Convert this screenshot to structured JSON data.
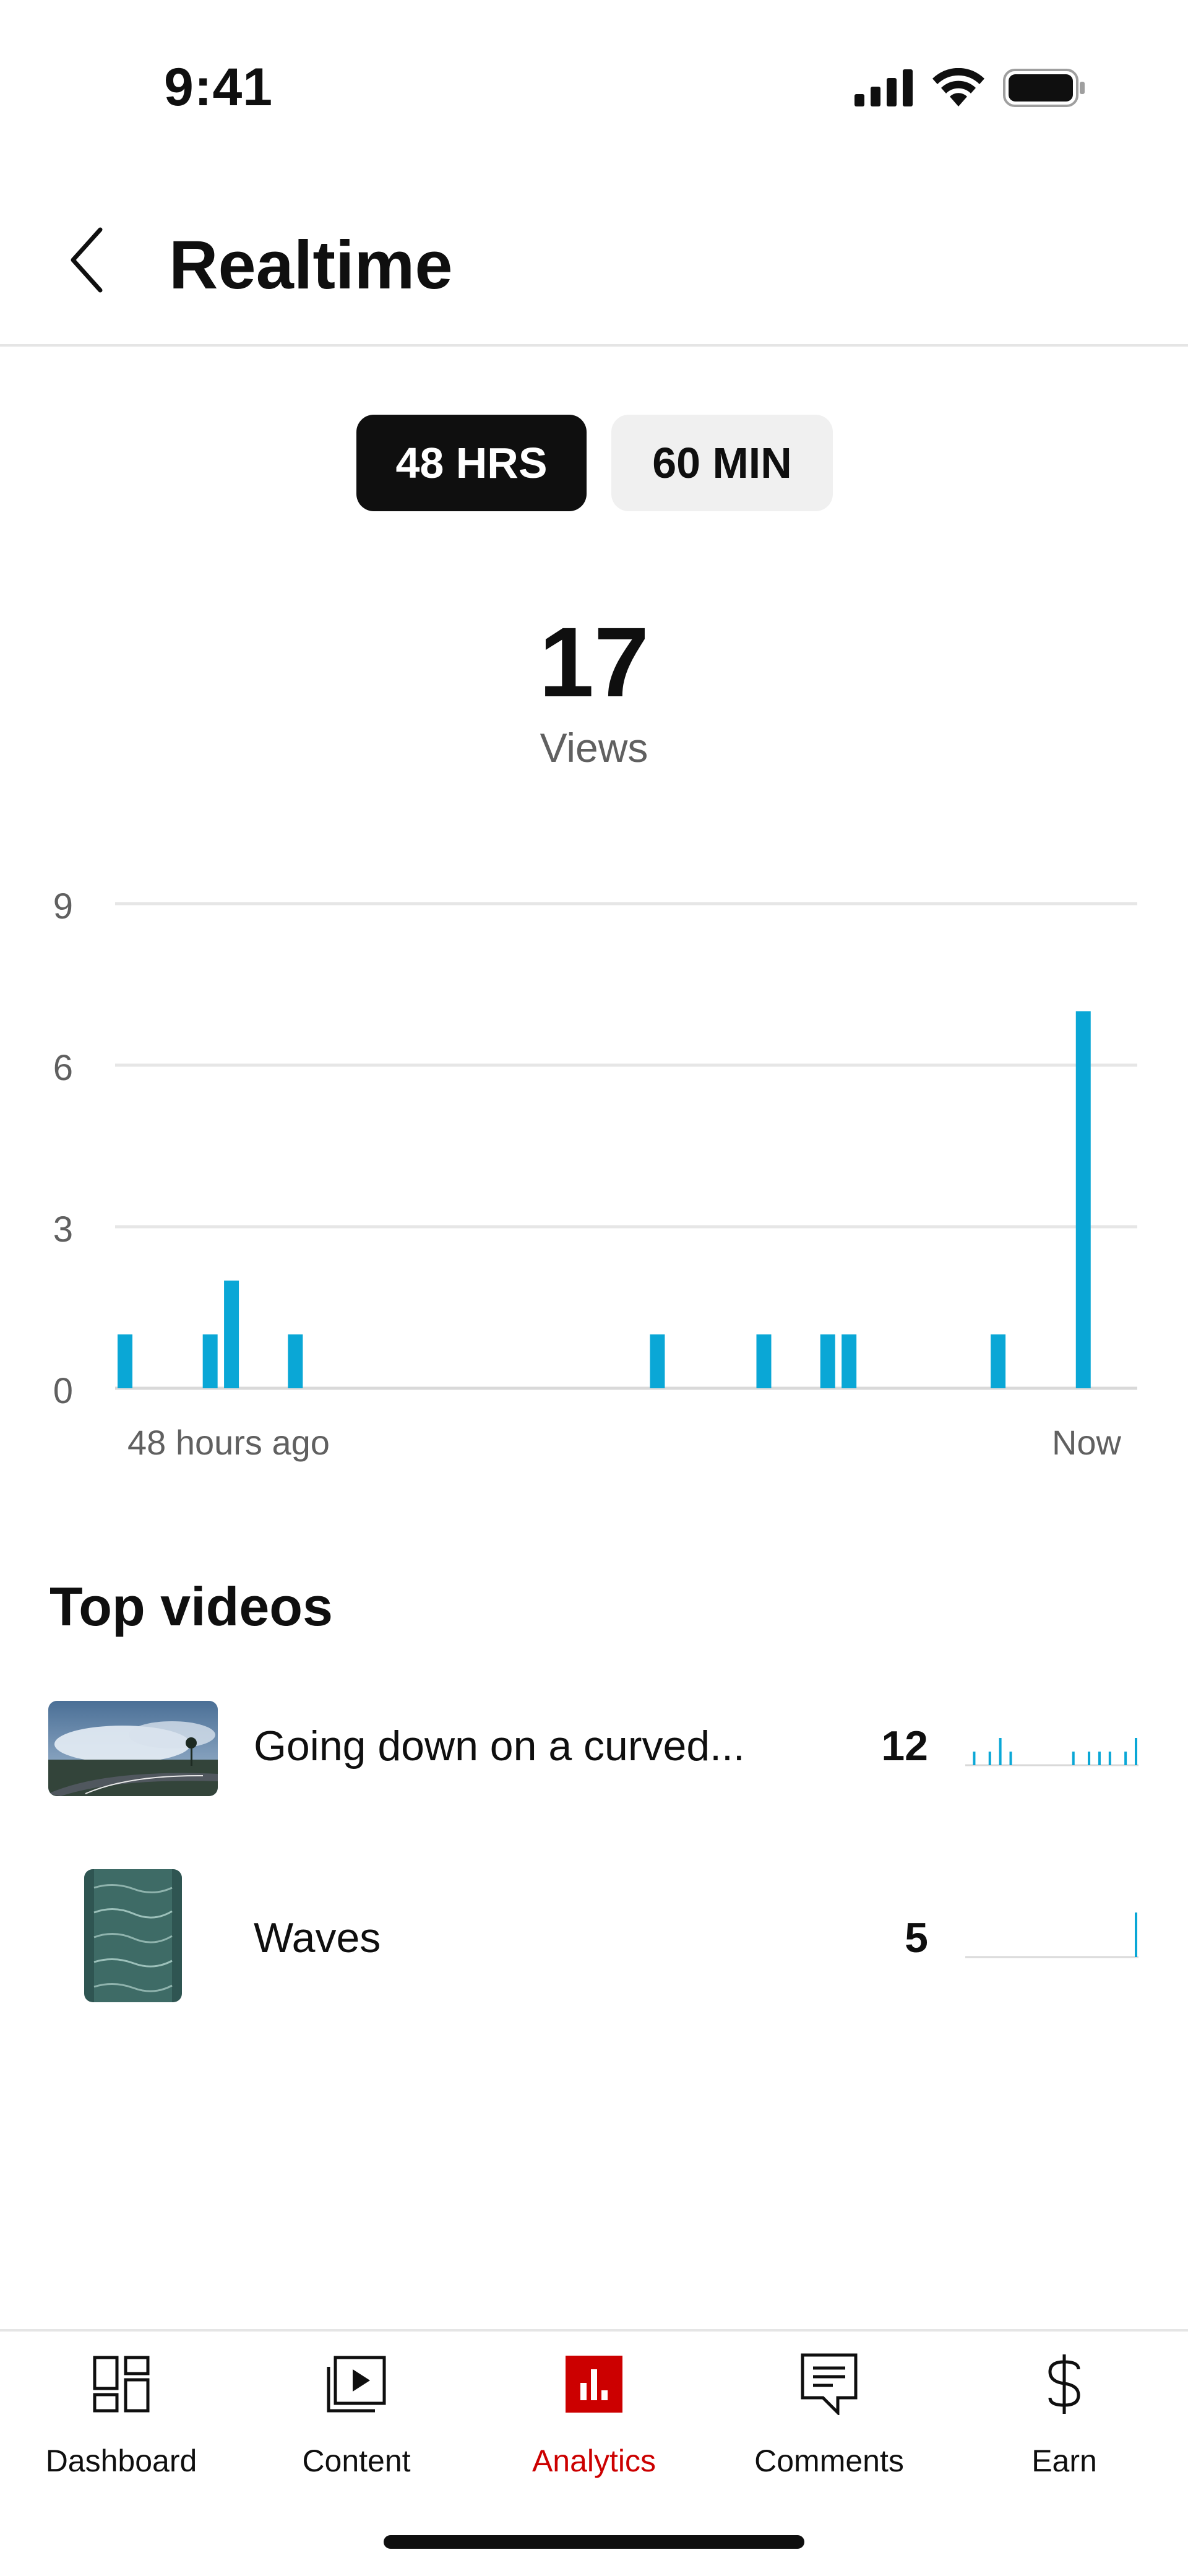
{
  "status_bar": {
    "time": "9:41"
  },
  "header": {
    "title": "Realtime"
  },
  "range_toggle": {
    "options": [
      "48 HRS",
      "60 MIN"
    ],
    "selected": "48 HRS"
  },
  "summary": {
    "views_count": "17",
    "views_label": "Views"
  },
  "chart_data": {
    "type": "bar",
    "x_start_label": "48 hours ago",
    "x_end_label": "Now",
    "yticks": [
      0,
      3,
      6,
      9
    ],
    "ylim": [
      0,
      9
    ],
    "grid": true,
    "color": "#0aa7d6",
    "bins": 48,
    "bars": [
      {
        "bin": 0,
        "value": 1
      },
      {
        "bin": 4,
        "value": 1
      },
      {
        "bin": 5,
        "value": 2
      },
      {
        "bin": 8,
        "value": 1
      },
      {
        "bin": 25,
        "value": 1
      },
      {
        "bin": 30,
        "value": 1
      },
      {
        "bin": 33,
        "value": 1
      },
      {
        "bin": 34,
        "value": 1
      },
      {
        "bin": 41,
        "value": 1
      },
      {
        "bin": 45,
        "value": 7
      }
    ]
  },
  "top_videos": {
    "title": "Top videos",
    "items": [
      {
        "title": "Going down on a curved...",
        "views": "12",
        "spark": [
          0,
          1,
          0,
          0,
          1,
          0,
          2,
          0,
          1,
          0,
          0,
          0,
          0,
          0,
          0,
          0,
          0,
          0,
          0,
          0,
          1,
          0,
          0,
          1,
          0,
          1,
          0,
          1,
          0,
          0,
          1,
          0,
          2
        ]
      },
      {
        "title": "Waves",
        "views": "5",
        "spark": [
          0,
          0,
          0,
          0,
          0,
          0,
          0,
          0,
          0,
          0,
          0,
          0,
          0,
          0,
          0,
          0,
          0,
          0,
          0,
          0,
          0,
          0,
          0,
          0,
          0,
          0,
          0,
          0,
          0,
          0,
          0,
          0,
          5
        ]
      }
    ]
  },
  "bottom_nav": {
    "items": [
      {
        "label": "Dashboard",
        "icon": "dashboard-icon"
      },
      {
        "label": "Content",
        "icon": "content-icon"
      },
      {
        "label": "Analytics",
        "icon": "analytics-icon",
        "active": true
      },
      {
        "label": "Comments",
        "icon": "comments-icon"
      },
      {
        "label": "Earn",
        "icon": "earn-icon"
      }
    ],
    "accent": "#cc0000"
  }
}
